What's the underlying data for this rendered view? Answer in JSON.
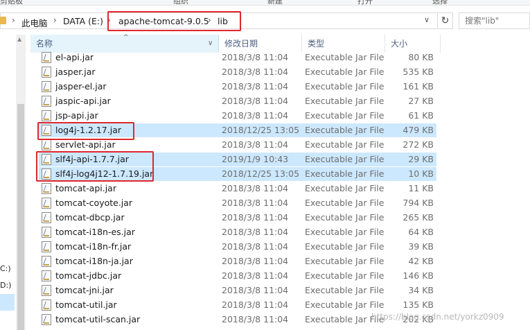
{
  "ribbon": {
    "labels": [
      "剪贴板",
      "组织",
      "新建",
      "打开",
      "选择"
    ]
  },
  "address": {
    "segments": [
      "此电脑",
      "DATA (E:)",
      "apache-tomcat-9.0.5",
      "lib"
    ],
    "search_placeholder": "搜索\"lib\"",
    "refresh_glyph": "↻",
    "dropdown_glyph": "∨",
    "separator_glyph": "›"
  },
  "nav": {
    "drives": [
      "C:)",
      "D:)"
    ]
  },
  "columns": {
    "name": "名称",
    "date": "修改日期",
    "type": "类型",
    "size": "大小"
  },
  "files": [
    {
      "name": "el-api.jar",
      "date": "2018/3/8 11:04",
      "type": "Executable Jar File",
      "size": "80 KB",
      "selected": false
    },
    {
      "name": "jasper.jar",
      "date": "2018/3/8 11:04",
      "type": "Executable Jar File",
      "size": "535 KB",
      "selected": false
    },
    {
      "name": "jasper-el.jar",
      "date": "2018/3/8 11:04",
      "type": "Executable Jar File",
      "size": "161 KB",
      "selected": false
    },
    {
      "name": "jaspic-api.jar",
      "date": "2018/3/8 11:04",
      "type": "Executable Jar File",
      "size": "27 KB",
      "selected": false
    },
    {
      "name": "jsp-api.jar",
      "date": "2018/3/8 11:04",
      "type": "Executable Jar File",
      "size": "61 KB",
      "selected": false
    },
    {
      "name": "log4j-1.2.17.jar",
      "date": "2018/12/25 13:05",
      "type": "Executable Jar File",
      "size": "479 KB",
      "selected": true
    },
    {
      "name": "servlet-api.jar",
      "date": "2018/3/8 11:04",
      "type": "Executable Jar File",
      "size": "272 KB",
      "selected": false
    },
    {
      "name": "slf4j-api-1.7.7.jar",
      "date": "2019/1/9 10:43",
      "type": "Executable Jar File",
      "size": "29 KB",
      "selected": true
    },
    {
      "name": "slf4j-log4j12-1.7.19.jar",
      "date": "2018/12/25 13:05",
      "type": "Executable Jar File",
      "size": "10 KB",
      "selected": true
    },
    {
      "name": "tomcat-api.jar",
      "date": "2018/3/8 11:04",
      "type": "Executable Jar File",
      "size": "11 KB",
      "selected": false
    },
    {
      "name": "tomcat-coyote.jar",
      "date": "2018/3/8 11:04",
      "type": "Executable Jar File",
      "size": "794 KB",
      "selected": false
    },
    {
      "name": "tomcat-dbcp.jar",
      "date": "2018/3/8 11:04",
      "type": "Executable Jar File",
      "size": "265 KB",
      "selected": false
    },
    {
      "name": "tomcat-i18n-es.jar",
      "date": "2018/3/8 11:04",
      "type": "Executable Jar File",
      "size": "64 KB",
      "selected": false
    },
    {
      "name": "tomcat-i18n-fr.jar",
      "date": "2018/3/8 11:04",
      "type": "Executable Jar File",
      "size": "39 KB",
      "selected": false
    },
    {
      "name": "tomcat-i18n-ja.jar",
      "date": "2018/3/8 11:04",
      "type": "Executable Jar File",
      "size": "42 KB",
      "selected": false
    },
    {
      "name": "tomcat-jdbc.jar",
      "date": "2018/3/8 11:04",
      "type": "Executable Jar File",
      "size": "146 KB",
      "selected": false
    },
    {
      "name": "tomcat-jni.jar",
      "date": "2018/3/8 11:04",
      "type": "Executable Jar File",
      "size": "34 KB",
      "selected": false
    },
    {
      "name": "tomcat-util.jar",
      "date": "2018/3/8 11:04",
      "type": "Executable Jar File",
      "size": "135 KB",
      "selected": false
    },
    {
      "name": "tomcat-util-scan.jar",
      "date": "2018/3/8 11:04",
      "type": "Executable Jar File",
      "size": "202 KB",
      "selected": false
    }
  ],
  "watermark": "https://blog.csdn.net/yorkz0909",
  "colors": {
    "selection": "#cce8ff",
    "highlight": "#e0262b",
    "header_text": "#4d6082"
  }
}
